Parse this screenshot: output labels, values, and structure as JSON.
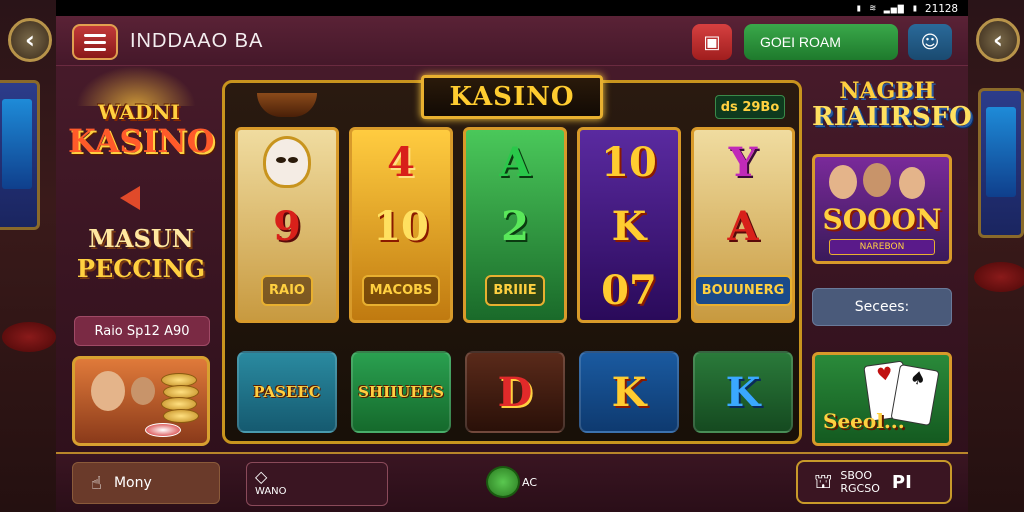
{
  "status_bar": {
    "icons": "▮ ≋ ▂▄▆ ▮",
    "time": "21128"
  },
  "header": {
    "back_icon": "‹",
    "title": "INDDAAO BA",
    "menu_icon": "hamburger-icon",
    "gift_icon": "gift-icon",
    "green_button": "GOEI ROAM",
    "profile_icon": "profile-icon",
    "close_icon": "‹"
  },
  "left_panel": {
    "logo_line1": "WADNI",
    "logo_line2": "KASINO",
    "logo2_line1": "MASUN",
    "logo2_line2": "PECCING",
    "promo_text": "Raio Sp12 A90"
  },
  "reels": {
    "banner": "KASINO",
    "bet": "ds 29Bo",
    "columns": [
      {
        "symbols": [
          "mask",
          "9",
          "RAIO"
        ]
      },
      {
        "symbols": [
          "4",
          "10",
          "MACOBS"
        ]
      },
      {
        "symbols": [
          "A",
          "2",
          "BRIIIE"
        ]
      },
      {
        "symbols": [
          "10",
          "K",
          "07"
        ]
      },
      {
        "symbols": [
          "Y",
          "A",
          "BOUUNERG"
        ]
      }
    ],
    "colors": {
      "symbol_red": "#d8201a",
      "symbol_gold": "#ffcc30",
      "symbol_green": "#1a8a2a",
      "symbol_purple": "#c02ab8"
    },
    "tiles": [
      "PASEEC",
      "SHIIUEES",
      "D",
      "K",
      "K"
    ]
  },
  "right_panel": {
    "logo_line1": "NAGBH",
    "logo_line2": "RIAIIRSFO",
    "card_title": "SOOON",
    "card_sub": "NAREBON",
    "secs_label": "Secees:",
    "cards_text": "Seeol..."
  },
  "bottom_bar": {
    "btn1_label": "Mony",
    "btn2_label": "WANO",
    "mid_label": "AC",
    "btn3_line1": "SBOO",
    "btn3_line2": "RGCSO",
    "btn3_suffix": "PI"
  }
}
